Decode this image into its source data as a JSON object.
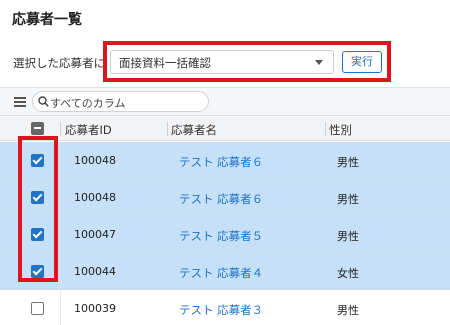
{
  "page": {
    "title": "応募者一覧"
  },
  "bulk_action": {
    "label": "選択した応募者に",
    "selected_option": "面接資料一括確認",
    "run_label": "実行"
  },
  "grid": {
    "search_placeholder": "すべてのカラム",
    "columns": [
      "応募者ID",
      "応募者名",
      "性別"
    ],
    "rows": [
      {
        "id": "100048",
        "name": "テスト 応募者６",
        "gender": "男性",
        "checked": true
      },
      {
        "id": "100048",
        "name": "テスト 応募者６",
        "gender": "男性",
        "checked": true
      },
      {
        "id": "100047",
        "name": "テスト 応募者５",
        "gender": "男性",
        "checked": true
      },
      {
        "id": "100044",
        "name": "テスト 応募者４",
        "gender": "女性",
        "checked": true
      },
      {
        "id": "100039",
        "name": "テスト 応募者３",
        "gender": "男性",
        "checked": false
      }
    ]
  },
  "colors": {
    "accent": "#1f73c8",
    "selected_row": "#c5e0f7",
    "highlight": "#e0141e"
  }
}
